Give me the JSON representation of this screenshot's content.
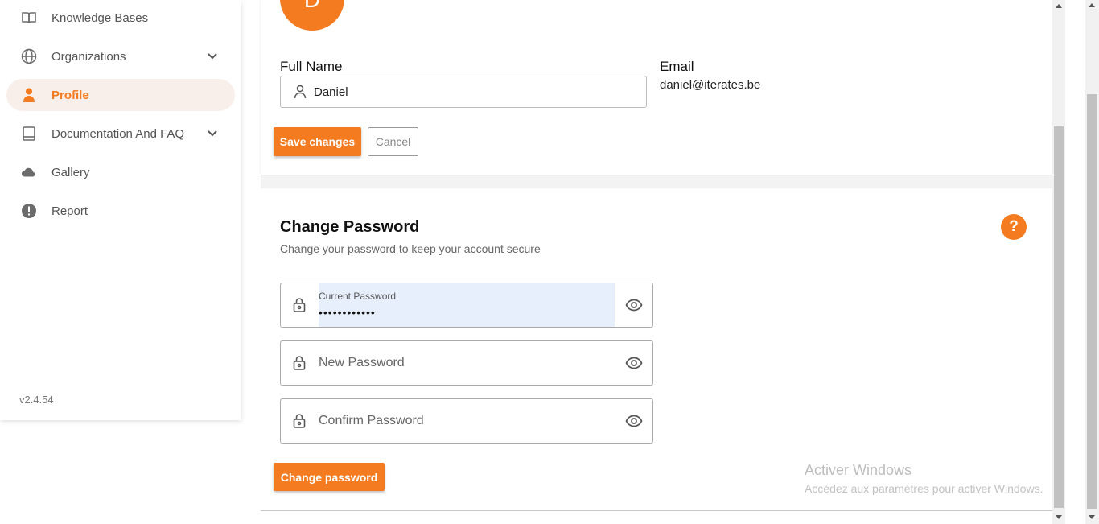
{
  "sidebar": {
    "items": [
      {
        "label": "Knowledge Bases",
        "icon": "book-open-icon"
      },
      {
        "label": "Organizations",
        "icon": "globe-icon"
      },
      {
        "label": "Profile",
        "icon": "user-icon"
      },
      {
        "label": "Documentation And FAQ",
        "icon": "book-icon"
      },
      {
        "label": "Gallery",
        "icon": "cloud-icon"
      },
      {
        "label": "Report",
        "icon": "alert-icon"
      }
    ],
    "version": "v2.4.54"
  },
  "profile": {
    "avatar_initial": "D",
    "full_name_label": "Full Name",
    "full_name_value": "Daniel",
    "email_label": "Email",
    "email_value": "daniel@iterates.be",
    "save_label": "Save changes",
    "cancel_label": "Cancel"
  },
  "password": {
    "title": "Change Password",
    "subtitle": "Change your password to keep your account secure",
    "help_label": "?",
    "current_label": "Current Password",
    "current_value": "••••••••••••",
    "new_placeholder": "New Password",
    "confirm_placeholder": "Confirm Password",
    "submit_label": "Change password"
  },
  "watermark": {
    "title": "Activer Windows",
    "subtitle": "Accédez aux paramètres pour activer Windows."
  },
  "colors": {
    "accent": "#f47b20",
    "active_bg": "#f8efea",
    "autofill_bg": "#e8effc"
  }
}
